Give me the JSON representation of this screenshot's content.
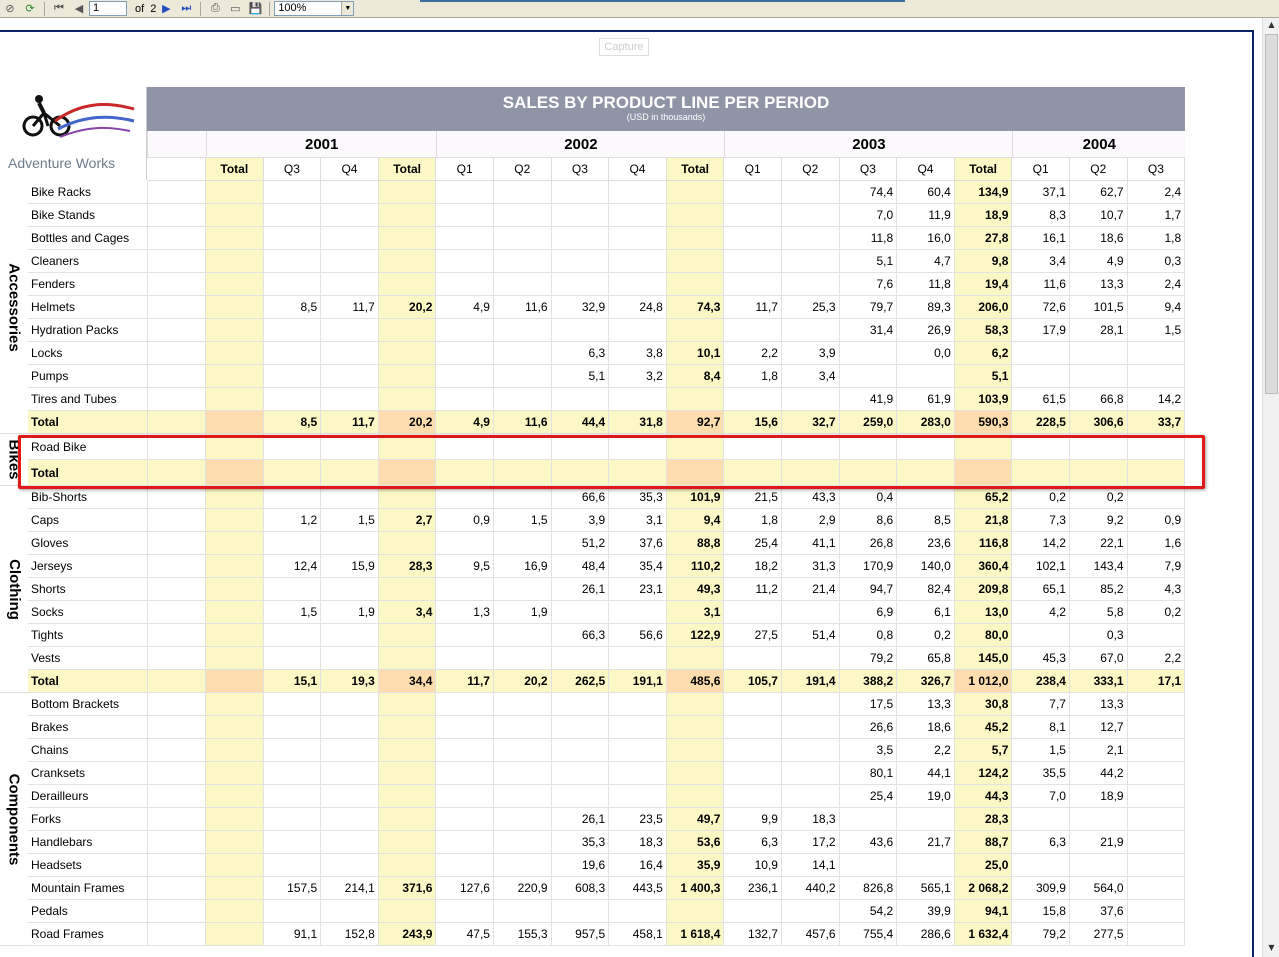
{
  "toolbar": {
    "page": "1",
    "of_label": "of",
    "total_pages": "2",
    "zoom": "100%"
  },
  "capture_label": "Capture",
  "logo_text": "Adventure Works",
  "report": {
    "title": "SALES BY PRODUCT LINE PER PERIOD",
    "subtitle": "(USD in thousands)"
  },
  "years": [
    "2001",
    "2002",
    "2003",
    "2004"
  ],
  "quarters": [
    "Total",
    "Q3",
    "Q4",
    "Total",
    "Q1",
    "Q2",
    "Q3",
    "Q4",
    "Total",
    "Q1",
    "Q2",
    "Q3",
    "Q4",
    "Total",
    "Q1",
    "Q2",
    "Q3"
  ],
  "categories": [
    {
      "name": "Accessories",
      "rows": [
        {
          "label": "Bike Racks",
          "v": [
            "",
            "",
            "",
            "",
            "",
            "",
            "",
            "",
            "",
            "",
            "",
            "74,4",
            "60,4",
            "134,9",
            "37,1",
            "62,7",
            "2,4"
          ]
        },
        {
          "label": "Bike Stands",
          "v": [
            "",
            "",
            "",
            "",
            "",
            "",
            "",
            "",
            "",
            "",
            "",
            "7,0",
            "11,9",
            "18,9",
            "8,3",
            "10,7",
            "1,7"
          ]
        },
        {
          "label": "Bottles and Cages",
          "v": [
            "",
            "",
            "",
            "",
            "",
            "",
            "",
            "",
            "",
            "",
            "",
            "11,8",
            "16,0",
            "27,8",
            "16,1",
            "18,6",
            "1,8"
          ]
        },
        {
          "label": "Cleaners",
          "v": [
            "",
            "",
            "",
            "",
            "",
            "",
            "",
            "",
            "",
            "",
            "",
            "5,1",
            "4,7",
            "9,8",
            "3,4",
            "4,9",
            "0,3"
          ]
        },
        {
          "label": "Fenders",
          "v": [
            "",
            "",
            "",
            "",
            "",
            "",
            "",
            "",
            "",
            "",
            "",
            "7,6",
            "11,8",
            "19,4",
            "11,6",
            "13,3",
            "2,4"
          ]
        },
        {
          "label": "Helmets",
          "v": [
            "",
            "8,5",
            "11,7",
            "20,2",
            "4,9",
            "11,6",
            "32,9",
            "24,8",
            "74,3",
            "11,7",
            "25,3",
            "79,7",
            "89,3",
            "206,0",
            "72,6",
            "101,5",
            "9,4"
          ]
        },
        {
          "label": "Hydration Packs",
          "v": [
            "",
            "",
            "",
            "",
            "",
            "",
            "",
            "",
            "",
            "",
            "",
            "31,4",
            "26,9",
            "58,3",
            "17,9",
            "28,1",
            "1,5"
          ]
        },
        {
          "label": "Locks",
          "v": [
            "",
            "",
            "",
            "",
            "",
            "",
            "6,3",
            "3,8",
            "10,1",
            "2,2",
            "3,9",
            "",
            "0,0",
            "6,2",
            "",
            "",
            ""
          ]
        },
        {
          "label": "Pumps",
          "v": [
            "",
            "",
            "",
            "",
            "",
            "",
            "5,1",
            "3,2",
            "8,4",
            "1,8",
            "3,4",
            "",
            "",
            "5,1",
            "",
            "",
            ""
          ]
        },
        {
          "label": "Tires and Tubes",
          "v": [
            "",
            "",
            "",
            "",
            "",
            "",
            "",
            "",
            "",
            "",
            "",
            "41,9",
            "61,9",
            "103,9",
            "61,5",
            "66,8",
            "14,2"
          ]
        },
        {
          "label": "Total",
          "total": true,
          "v": [
            "",
            "8,5",
            "11,7",
            "20,2",
            "4,9",
            "11,6",
            "44,4",
            "31,8",
            "92,7",
            "15,6",
            "32,7",
            "259,0",
            "283,0",
            "590,3",
            "228,5",
            "306,6",
            "33,7"
          ]
        }
      ]
    },
    {
      "name": "Bikes",
      "rows": [
        {
          "label": "Road Bike",
          "v": [
            "",
            "",
            "",
            "",
            "",
            "",
            "",
            "",
            "",
            "",
            "",
            "",
            "",
            "",
            "",
            "",
            ""
          ]
        },
        {
          "label": "Total",
          "total": true,
          "v": [
            "",
            "",
            "",
            "",
            "",
            "",
            "",
            "",
            "",
            "",
            "",
            "",
            "",
            "",
            "",
            "",
            ""
          ]
        }
      ]
    },
    {
      "name": "Clothing",
      "rows": [
        {
          "label": "Bib-Shorts",
          "v": [
            "",
            "",
            "",
            "",
            "",
            "",
            "66,6",
            "35,3",
            "101,9",
            "21,5",
            "43,3",
            "0,4",
            "",
            "65,2",
            "0,2",
            "0,2",
            ""
          ]
        },
        {
          "label": "Caps",
          "v": [
            "",
            "1,2",
            "1,5",
            "2,7",
            "0,9",
            "1,5",
            "3,9",
            "3,1",
            "9,4",
            "1,8",
            "2,9",
            "8,6",
            "8,5",
            "21,8",
            "7,3",
            "9,2",
            "0,9"
          ]
        },
        {
          "label": "Gloves",
          "v": [
            "",
            "",
            "",
            "",
            "",
            "",
            "51,2",
            "37,6",
            "88,8",
            "25,4",
            "41,1",
            "26,8",
            "23,6",
            "116,8",
            "14,2",
            "22,1",
            "1,6"
          ]
        },
        {
          "label": "Jerseys",
          "v": [
            "",
            "12,4",
            "15,9",
            "28,3",
            "9,5",
            "16,9",
            "48,4",
            "35,4",
            "110,2",
            "18,2",
            "31,3",
            "170,9",
            "140,0",
            "360,4",
            "102,1",
            "143,4",
            "7,9"
          ]
        },
        {
          "label": "Shorts",
          "v": [
            "",
            "",
            "",
            "",
            "",
            "",
            "26,1",
            "23,1",
            "49,3",
            "11,2",
            "21,4",
            "94,7",
            "82,4",
            "209,8",
            "65,1",
            "85,2",
            "4,3"
          ]
        },
        {
          "label": "Socks",
          "v": [
            "",
            "1,5",
            "1,9",
            "3,4",
            "1,3",
            "1,9",
            "",
            "",
            "3,1",
            "",
            "",
            "6,9",
            "6,1",
            "13,0",
            "4,2",
            "5,8",
            "0,2"
          ]
        },
        {
          "label": "Tights",
          "v": [
            "",
            "",
            "",
            "",
            "",
            "",
            "66,3",
            "56,6",
            "122,9",
            "27,5",
            "51,4",
            "0,8",
            "0,2",
            "80,0",
            "",
            "0,3",
            ""
          ]
        },
        {
          "label": "Vests",
          "v": [
            "",
            "",
            "",
            "",
            "",
            "",
            "",
            "",
            "",
            "",
            "",
            "79,2",
            "65,8",
            "145,0",
            "45,3",
            "67,0",
            "2,2"
          ]
        },
        {
          "label": "Total",
          "total": true,
          "v": [
            "",
            "15,1",
            "19,3",
            "34,4",
            "11,7",
            "20,2",
            "262,5",
            "191,1",
            "485,6",
            "105,7",
            "191,4",
            "388,2",
            "326,7",
            "1 012,0",
            "238,4",
            "333,1",
            "17,1"
          ]
        }
      ]
    },
    {
      "name": "Components",
      "rows": [
        {
          "label": "Bottom Brackets",
          "v": [
            "",
            "",
            "",
            "",
            "",
            "",
            "",
            "",
            "",
            "",
            "",
            "17,5",
            "13,3",
            "30,8",
            "7,7",
            "13,3",
            ""
          ]
        },
        {
          "label": "Brakes",
          "v": [
            "",
            "",
            "",
            "",
            "",
            "",
            "",
            "",
            "",
            "",
            "",
            "26,6",
            "18,6",
            "45,2",
            "8,1",
            "12,7",
            ""
          ]
        },
        {
          "label": "Chains",
          "v": [
            "",
            "",
            "",
            "",
            "",
            "",
            "",
            "",
            "",
            "",
            "",
            "3,5",
            "2,2",
            "5,7",
            "1,5",
            "2,1",
            ""
          ]
        },
        {
          "label": "Cranksets",
          "v": [
            "",
            "",
            "",
            "",
            "",
            "",
            "",
            "",
            "",
            "",
            "",
            "80,1",
            "44,1",
            "124,2",
            "35,5",
            "44,2",
            ""
          ]
        },
        {
          "label": "Derailleurs",
          "v": [
            "",
            "",
            "",
            "",
            "",
            "",
            "",
            "",
            "",
            "",
            "",
            "25,4",
            "19,0",
            "44,3",
            "7,0",
            "18,9",
            ""
          ]
        },
        {
          "label": "Forks",
          "v": [
            "",
            "",
            "",
            "",
            "",
            "",
            "26,1",
            "23,5",
            "49,7",
            "9,9",
            "18,3",
            "",
            "",
            "28,3",
            "",
            "",
            ""
          ]
        },
        {
          "label": "Handlebars",
          "v": [
            "",
            "",
            "",
            "",
            "",
            "",
            "35,3",
            "18,3",
            "53,6",
            "6,3",
            "17,2",
            "43,6",
            "21,7",
            "88,7",
            "6,3",
            "21,9",
            ""
          ]
        },
        {
          "label": "Headsets",
          "v": [
            "",
            "",
            "",
            "",
            "",
            "",
            "19,6",
            "16,4",
            "35,9",
            "10,9",
            "14,1",
            "",
            "",
            "25,0",
            "",
            "",
            ""
          ]
        },
        {
          "label": "Mountain Frames",
          "v": [
            "",
            "157,5",
            "214,1",
            "371,6",
            "127,6",
            "220,9",
            "608,3",
            "443,5",
            "1 400,3",
            "236,1",
            "440,2",
            "826,8",
            "565,1",
            "2 068,2",
            "309,9",
            "564,0",
            ""
          ]
        },
        {
          "label": "Pedals",
          "v": [
            "",
            "",
            "",
            "",
            "",
            "",
            "",
            "",
            "",
            "",
            "",
            "54,2",
            "39,9",
            "94,1",
            "15,8",
            "37,6",
            ""
          ]
        },
        {
          "label": "Road Frames",
          "v": [
            "",
            "91,1",
            "152,8",
            "243,9",
            "47,5",
            "155,3",
            "957,5",
            "458,1",
            "1 618,4",
            "132,7",
            "457,6",
            "755,4",
            "286,6",
            "1 632,4",
            "79,2",
            "277,5",
            ""
          ]
        }
      ]
    }
  ]
}
